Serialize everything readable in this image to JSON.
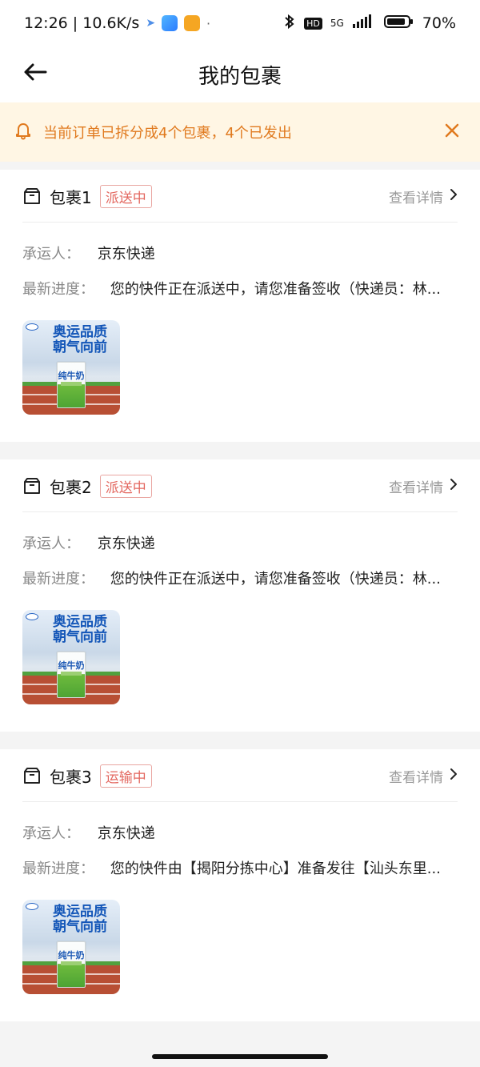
{
  "status_bar": {
    "time_speed": "12:26 | 10.6K/s",
    "separator": "·",
    "network": "5G",
    "battery": "70%"
  },
  "nav": {
    "title": "我的包裹"
  },
  "notice": {
    "text": "当前订单已拆分成4个包裹，4个已发出"
  },
  "labels": {
    "carrier": "承运人：",
    "progress": "最新进度：",
    "detail": "查看详情"
  },
  "packages": [
    {
      "name": "包裹1",
      "status": "派送中",
      "carrier": "京东快递",
      "progress": "您的快件正在派送中，请您准备签收（快递员：林..."
    },
    {
      "name": "包裹2",
      "status": "派送中",
      "carrier": "京东快递",
      "progress": "您的快件正在派送中，请您准备签收（快递员：林..."
    },
    {
      "name": "包裹3",
      "status": "运输中",
      "carrier": "京东快递",
      "progress": "您的快件由【揭阳分拣中心】准备发往【汕头东里..."
    }
  ],
  "product_image": {
    "headline": "奥运品质\n朝气向前",
    "box_label": "纯牛奶"
  },
  "icons": {
    "back": "back-arrow-icon",
    "bell": "bell-icon",
    "close": "close-icon",
    "box": "box-icon",
    "chevron": "chevron-right-icon"
  },
  "colors": {
    "accent": "#e07a1f",
    "notice_bg": "#fff6e4",
    "tag_red": "#e3675f"
  }
}
